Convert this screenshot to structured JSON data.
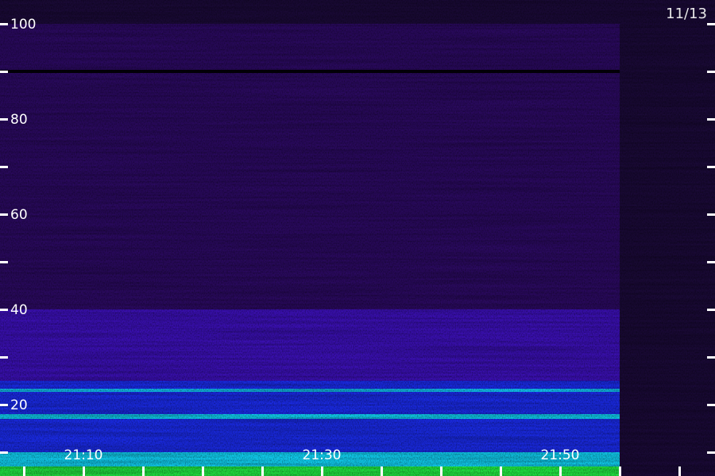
{
  "date_label": "11/13",
  "chart_data": {
    "type": "heatmap",
    "title": "",
    "xlabel": "",
    "ylabel": "",
    "y_axis": {
      "range": [
        0,
        100
      ],
      "tick_labels": [
        "100",
        "80",
        "60",
        "40",
        "20"
      ],
      "major_values": [
        100,
        80,
        60,
        40,
        20
      ],
      "minor_values": [
        90,
        70,
        50,
        30,
        10
      ]
    },
    "x_axis": {
      "tick_labels": [
        "21:10",
        "21:30",
        "21:50"
      ],
      "start": "21:03",
      "end": "22:03",
      "major_ticks": [
        "21:10",
        "21:30",
        "21:50"
      ],
      "minor_tick_interval_minutes": 5
    },
    "recording_end": "21:55",
    "bands": [
      {
        "low": 0,
        "high": 3,
        "level": "green-yellow"
      },
      {
        "low": 3,
        "high": 5,
        "level": "yellow-orange"
      },
      {
        "low": 5,
        "high": 7,
        "level": "green"
      },
      {
        "low": 7,
        "high": 10,
        "level": "cyan"
      },
      {
        "low": 10,
        "high": 17,
        "level": "blue"
      },
      {
        "low": 17,
        "high": 18,
        "level": "cyan"
      },
      {
        "low": 18,
        "high": 25,
        "level": "blue"
      },
      {
        "low": 25,
        "high": 40,
        "level": "indigo"
      },
      {
        "low": 40,
        "high": 100,
        "level": "dark-purple"
      }
    ],
    "lines": [
      {
        "value": 23,
        "level": "cyan"
      },
      {
        "value": 90,
        "level": "purple"
      }
    ],
    "colors": {
      "background": "#1a0a36",
      "dark-purple": "#2a0a5e",
      "indigo": "#3a10b0",
      "blue": "#1a2ae0",
      "cyan": "#10c8e8",
      "green": "#20e040",
      "green-yellow": "#a0f020",
      "yellow-orange": "#f0c010",
      "ticks": "#ffffff"
    }
  }
}
